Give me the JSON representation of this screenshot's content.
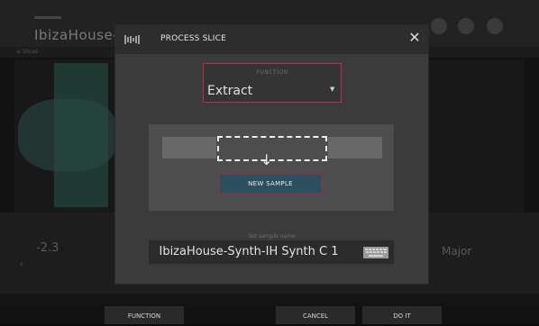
{
  "background": {
    "title": "IbizaHouse-Sy",
    "toolbar_label": "≡ Slices",
    "value_left": "-2.3",
    "mode": "Major",
    "arrow": "‹"
  },
  "dialog": {
    "title": "PROCESS SLICE",
    "logo_icon": "waveform-icon",
    "close_icon": "close-icon",
    "function": {
      "label": "FUNCTION",
      "value": "Extract",
      "caret": "▼"
    },
    "new_sample_label": "NEW SAMPLE",
    "arrow_glyph": "↓",
    "sample_name": {
      "label": "Set sample name",
      "value": "IbizaHouse-Synth-IH Synth C 1",
      "keyboard_icon": "keyboard-icon"
    }
  },
  "softkeys": {
    "function": "FUNCTION",
    "cancel": "CANCEL",
    "do_it": "DO IT"
  },
  "colors": {
    "accent_red": "#b4334a",
    "button_teal": "#2b4f5f"
  }
}
